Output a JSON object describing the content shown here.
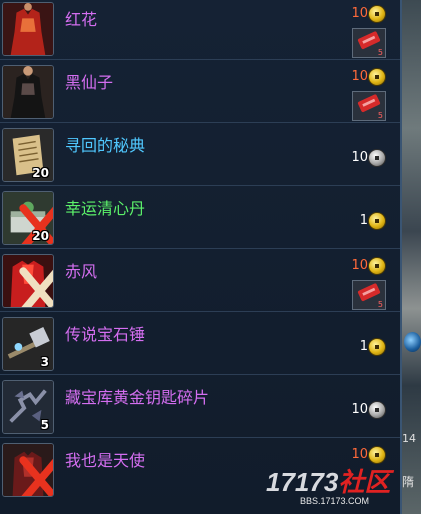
{
  "items": [
    {
      "name": "红花",
      "name_color": "#d46ef0",
      "price": "10",
      "price_color": "#ff6a3a",
      "currency": "gold-coin-icon",
      "quantity": "",
      "ticket": true,
      "ticket_qty": "5",
      "unavailable": false,
      "icon": "red-dress-icon"
    },
    {
      "name": "黑仙子",
      "name_color": "#d46ef0",
      "price": "10",
      "price_color": "#ff6a3a",
      "currency": "gold-coin-icon",
      "quantity": "",
      "ticket": true,
      "ticket_qty": "5",
      "unavailable": false,
      "icon": "black-dress-icon"
    },
    {
      "name": "寻回的秘典",
      "name_color": "#50c8ff",
      "price": "10",
      "price_color": "#ffffff",
      "currency": "silver-coin-icon",
      "quantity": "20",
      "ticket": false,
      "unavailable": false,
      "icon": "scroll-book-icon"
    },
    {
      "name": "幸运清心丹",
      "name_color": "#5cf26a",
      "price": "1",
      "price_color": "#ffffff",
      "currency": "gold-coin-icon",
      "quantity": "20",
      "ticket": false,
      "unavailable": true,
      "icon": "pill-box-icon"
    },
    {
      "name": "赤风",
      "name_color": "#d46ef0",
      "price": "10",
      "price_color": "#ff6a3a",
      "currency": "gold-coin-icon",
      "quantity": "",
      "ticket": true,
      "ticket_qty": "5",
      "unavailable": true,
      "icon": "red-outfit-icon"
    },
    {
      "name": "传说宝石锤",
      "name_color": "#d46ef0",
      "price": "1",
      "price_color": "#ffffff",
      "currency": "gold-coin-icon",
      "quantity": "3",
      "ticket": false,
      "unavailable": false,
      "icon": "gem-hammer-icon"
    },
    {
      "name": "藏宝库黄金钥匙碎片",
      "name_color": "#d46ef0",
      "price": "10",
      "price_color": "#ffffff",
      "currency": "silver-coin-icon",
      "quantity": "5",
      "ticket": false,
      "unavailable": false,
      "icon": "key-fragment-icon"
    },
    {
      "name": "我也是天使",
      "name_color": "#d46ef0",
      "price": "10",
      "price_color": "#ff6a3a",
      "currency": "gold-coin-icon",
      "quantity": "",
      "ticket": false,
      "unavailable": true,
      "icon": "angel-outfit-icon"
    }
  ],
  "watermark": {
    "brand_a": "17173",
    "brand_b": "社区",
    "url": "BBS.17173.COM"
  },
  "scene_text": {
    "a": "14",
    "b": "隋"
  }
}
